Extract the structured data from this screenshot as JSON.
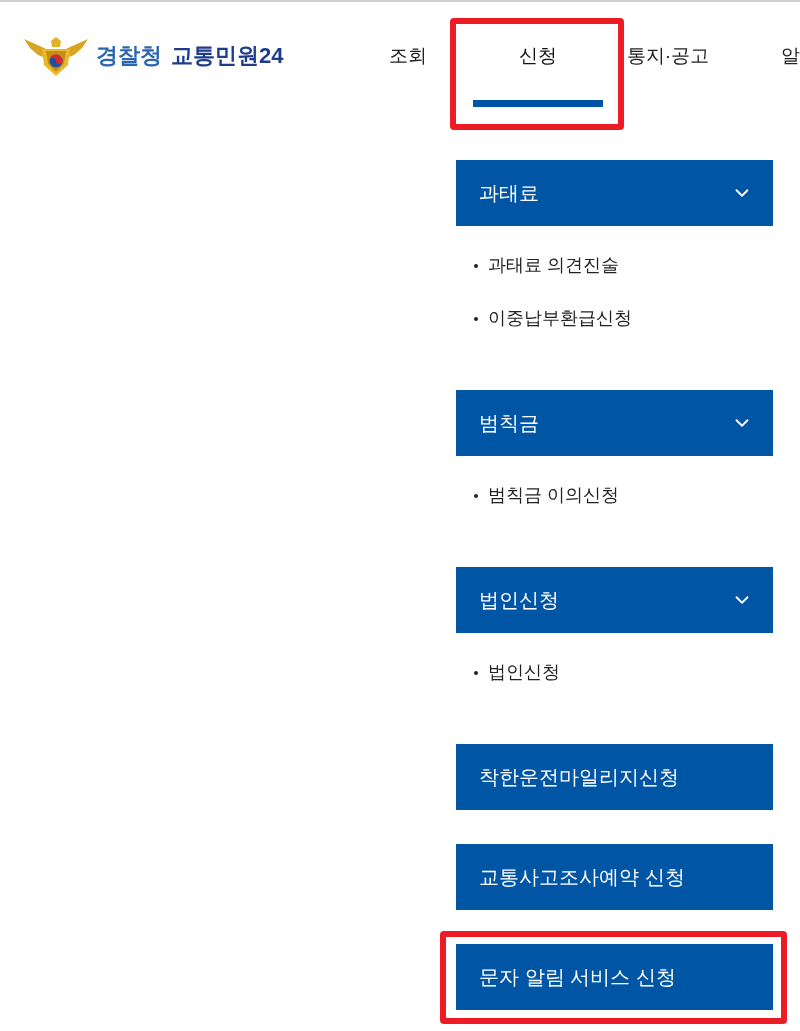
{
  "logo": {
    "agency": "경찰청",
    "service": "교통민원24"
  },
  "nav": [
    {
      "label": "조회",
      "selected": false,
      "highlighted": false
    },
    {
      "label": "신청",
      "selected": true,
      "highlighted": true
    },
    {
      "label": "통지·공고",
      "selected": false,
      "highlighted": false
    },
    {
      "label": "알",
      "selected": false,
      "highlighted": false
    }
  ],
  "menu": [
    {
      "kind": "group",
      "label": "과태료",
      "expanded": true,
      "highlighted": false,
      "children": [
        {
          "label": "과태료 의견진술"
        },
        {
          "label": "이중납부환급신청"
        }
      ]
    },
    {
      "kind": "group",
      "label": "범칙금",
      "expanded": true,
      "highlighted": false,
      "children": [
        {
          "label": "범칙금 이의신청"
        }
      ]
    },
    {
      "kind": "group",
      "label": "법인신청",
      "expanded": true,
      "highlighted": false,
      "children": [
        {
          "label": "법인신청"
        }
      ]
    },
    {
      "kind": "link",
      "label": "착한운전마일리지신청",
      "highlighted": false
    },
    {
      "kind": "link",
      "label": "교통사고조사예약 신청",
      "highlighted": false
    },
    {
      "kind": "link",
      "label": "문자 알림 서비스 신청",
      "highlighted": true
    }
  ]
}
